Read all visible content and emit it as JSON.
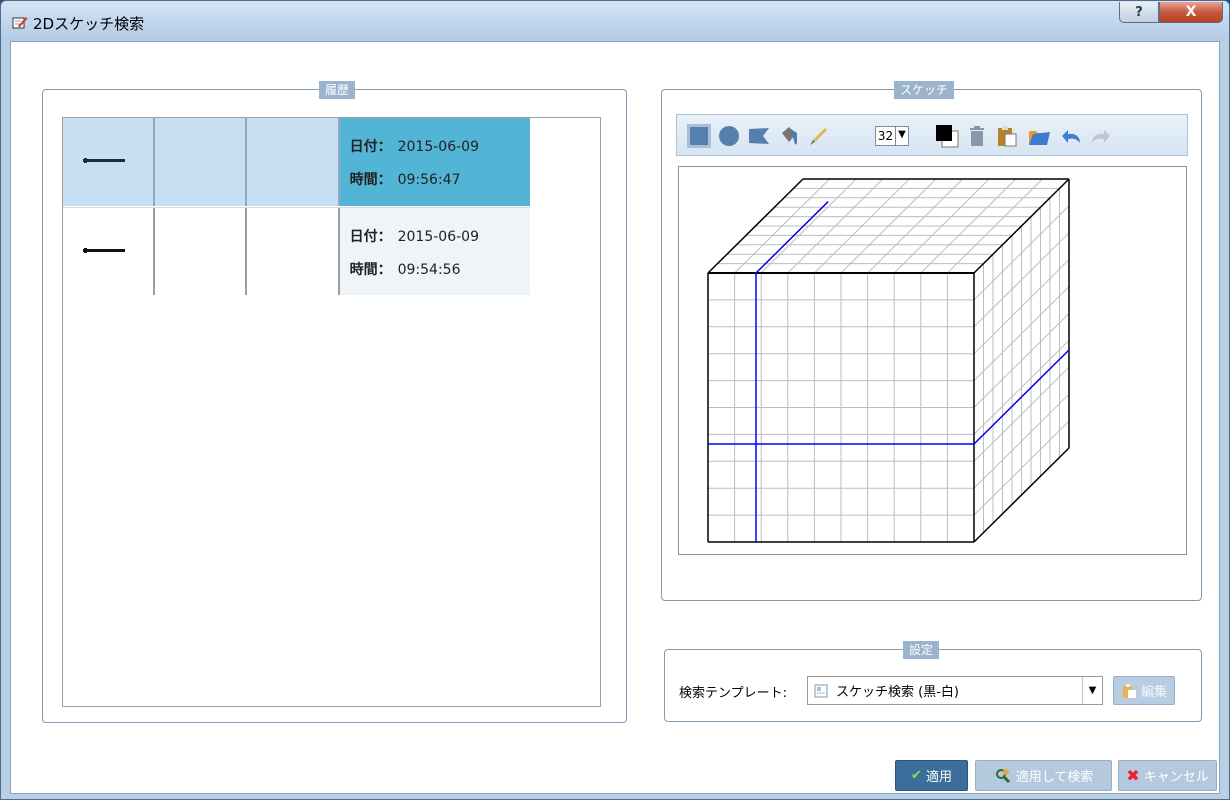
{
  "window": {
    "title": "2Dスケッチ検索",
    "help_label": "?",
    "close_label": "X"
  },
  "history": {
    "legend": "履歴",
    "rows": [
      {
        "date_label": "日付：",
        "date": "2015-06-09",
        "time_label": "時間：",
        "time": "09:56:47",
        "selected": true
      },
      {
        "date_label": "日付：",
        "date": "2015-06-09",
        "time_label": "時間：",
        "time": "09:54:56",
        "selected": false
      }
    ]
  },
  "sketch": {
    "legend": "スケッチ",
    "toolbar": {
      "brush_size": "32",
      "icons": [
        "rectangle-tool-icon",
        "ellipse-tool-icon",
        "polygon-tool-icon",
        "fill-bucket-icon",
        "brush-icon",
        "color-picker-icon",
        "trash-icon",
        "paste-icon",
        "open-folder-icon",
        "undo-icon",
        "redo-icon"
      ]
    }
  },
  "settings": {
    "legend": "設定",
    "template_label": "検索テンプレート:",
    "template_value": "スケッチ検索 (黒-白)",
    "edit_label": "編集"
  },
  "buttons": {
    "apply": "適用",
    "apply_and_search": "適用して検索",
    "cancel": "キャンセル"
  },
  "colors": {
    "accent": "#3d6d9a",
    "selected_row": "#52b5d6",
    "legend_bg": "#9bb3cc",
    "sketch_line": "#0000ff"
  }
}
